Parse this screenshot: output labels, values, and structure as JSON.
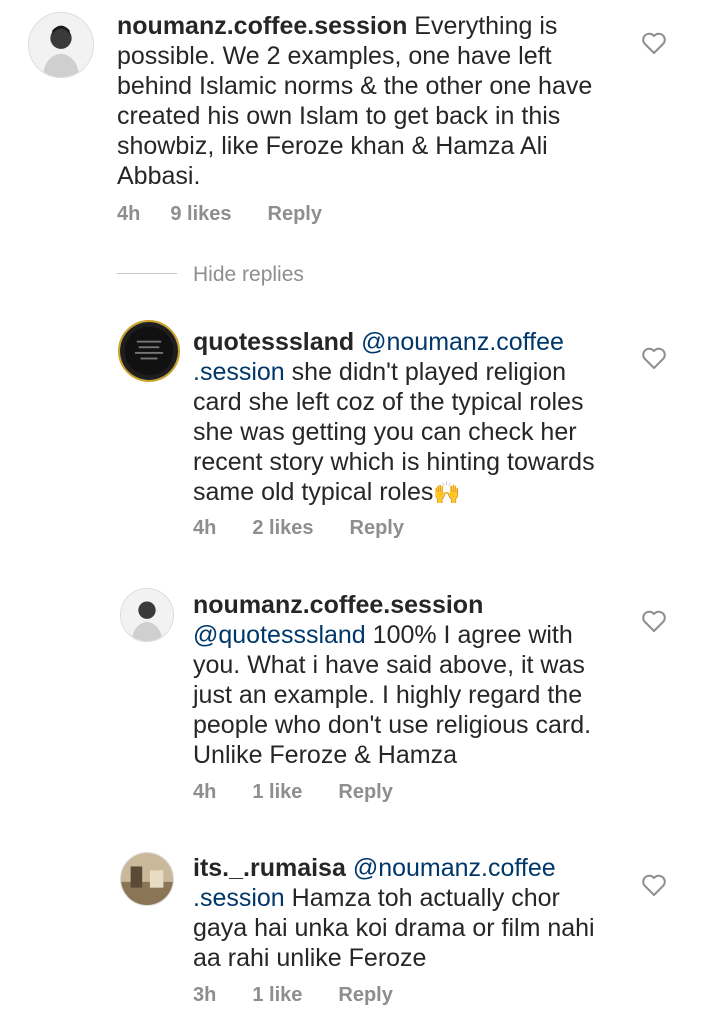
{
  "comments": [
    {
      "username": "noumanz.coffee.session",
      "mention": "",
      "text": " Everything is possible. We 2 examples, one have left behind Islamic norms & the other one have created his own Islam to get back in this showbiz, like Feroze khan & Hamza Ali Abbasi.",
      "time": "4h",
      "likes": "9 likes",
      "reply": "Reply"
    },
    {
      "username": "quotesssland",
      "mention": "@noumanz.coffee .session",
      "text": " she didn't played religion card she left coz of the typical roles she was getting you can check her recent story which is hinting towards same old typical roles",
      "emoji": "🙌",
      "time": "4h",
      "likes": "2 likes",
      "reply": "Reply"
    },
    {
      "username": "noumanz.coffee.session",
      "mention": "@quotesssland",
      "text": " 100% I agree with you. What i have said above, it was just an example. I highly regard the people who don't use religious card. Unlike Feroze & Hamza",
      "time": "4h",
      "likes": "1 like",
      "reply": "Reply"
    },
    {
      "username": "its._.rumaisa",
      "mention": "@noumanz.coffee .session",
      "text": " Hamza toh actually chor gaya hai unka koi drama or film nahi aa rahi unlike Feroze",
      "time": "3h",
      "likes": "1 like",
      "reply": "Reply"
    }
  ],
  "hide_replies": "Hide replies",
  "icons": {
    "like": "heart-outline-icon"
  },
  "colors": {
    "text": "#262626",
    "meta": "#8e8e8e",
    "mention": "#00376b"
  }
}
